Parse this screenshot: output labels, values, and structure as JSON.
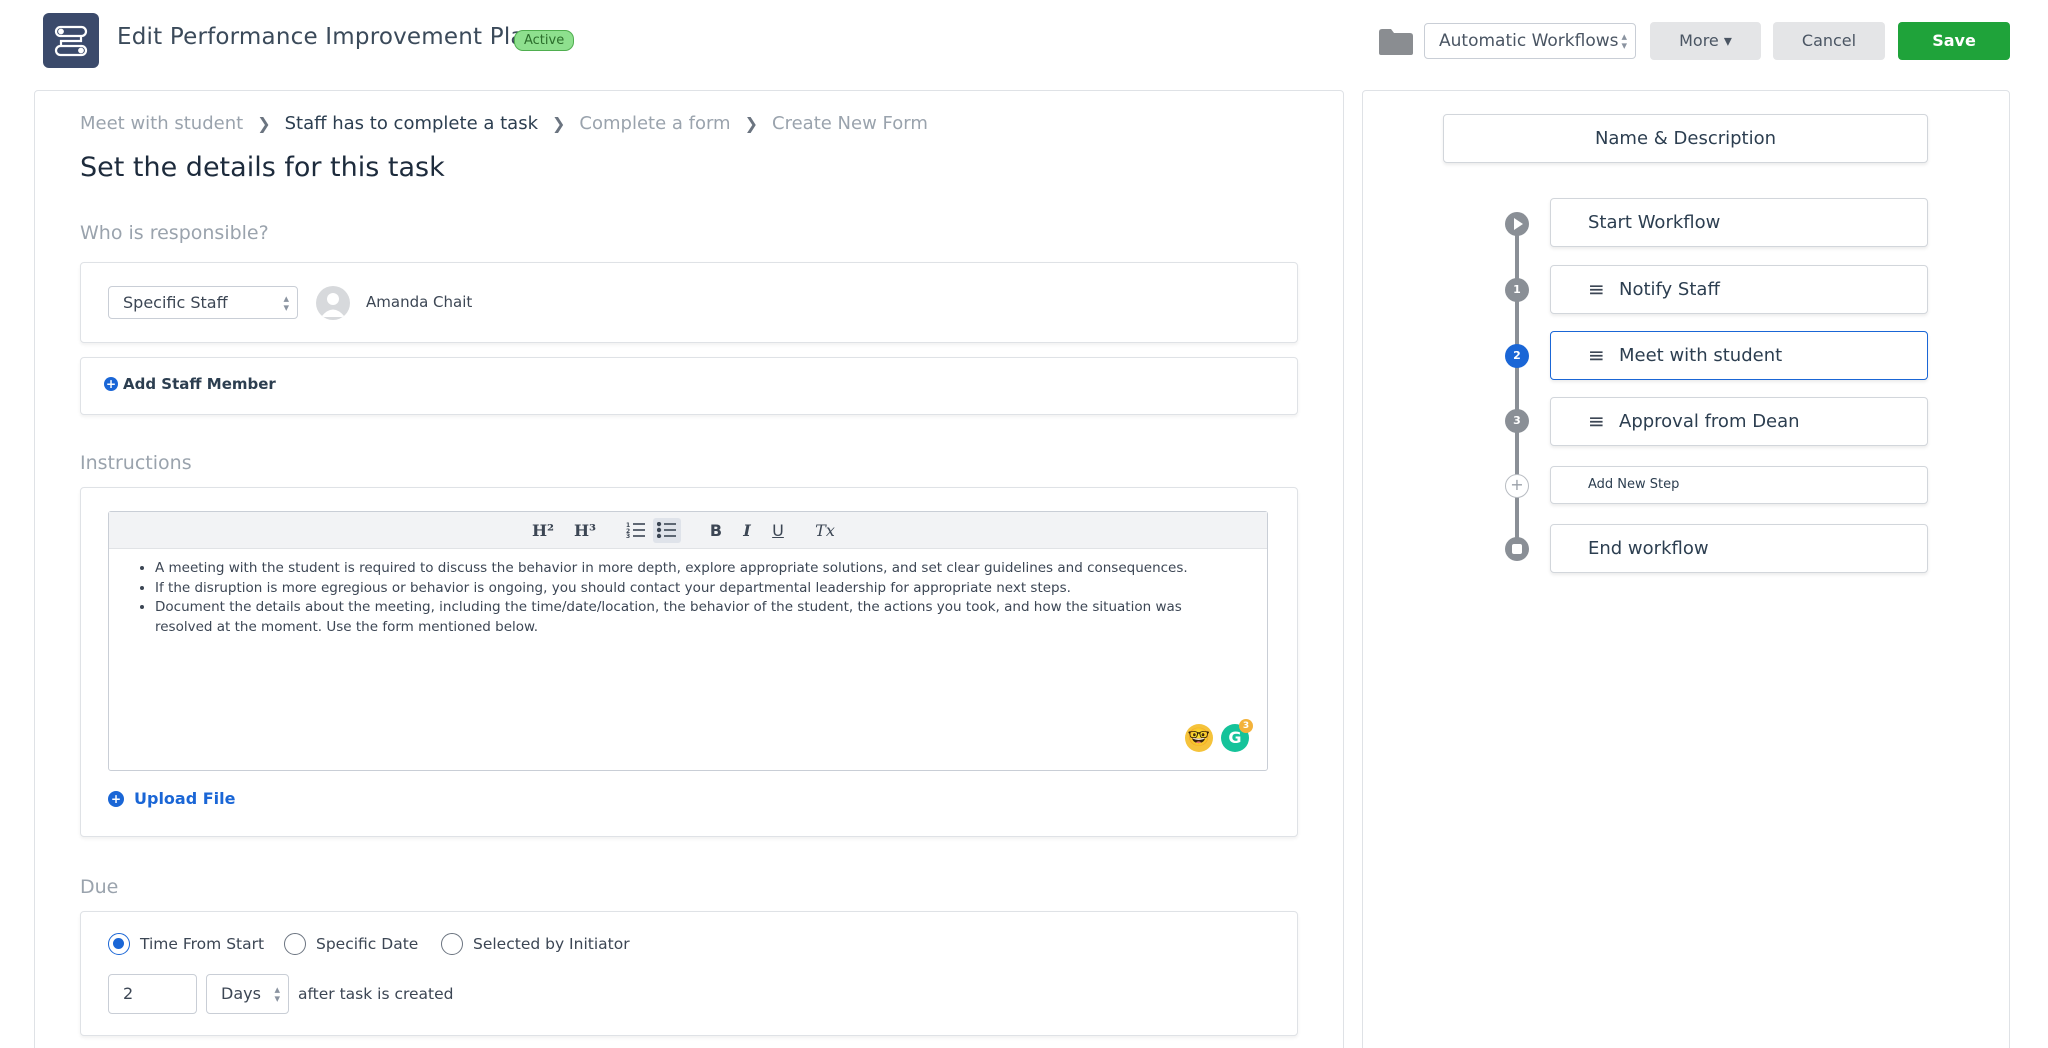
{
  "header": {
    "title": "Edit Performance Improvement Plan",
    "status_badge": "Active",
    "workflow_select": "Automatic Workflows",
    "more_label": "More",
    "cancel_label": "Cancel",
    "save_label": "Save"
  },
  "breadcrumb": [
    "Meet with student",
    "Staff has to complete a task",
    "Complete a form",
    "Create New Form"
  ],
  "task": {
    "title": "Set the details for this task",
    "responsible_label": "Who is responsible?",
    "responsible_type": "Specific Staff",
    "staff_name": "Amanda Chait",
    "add_staff_label": "Add Staff Member",
    "instructions_label": "Instructions",
    "instructions": [
      "A meeting with the student is required to discuss the behavior in more depth, explore appropriate solutions, and set clear guidelines and consequences.",
      "If the disruption is more egregious or behavior is ongoing, you should contact your departmental leadership for appropriate next steps.",
      "Document the details about the meeting, including the time/date/location, the behavior of the student, the actions you took, and how the situation was resolved at the moment. Use the form mentioned below."
    ],
    "grammarly_count": "3",
    "upload_label": "Upload File",
    "due_label": "Due",
    "due_options": [
      "Time From Start",
      "Specific Date",
      "Selected by Initiator"
    ],
    "due_selected": "Time From Start",
    "due_amount": "2",
    "due_unit": "Days",
    "due_suffix": "after task is created"
  },
  "toolbar": {
    "h2": "H²",
    "h3": "H³",
    "bold": "B",
    "italic": "I",
    "underline": "U",
    "clear": "Tx"
  },
  "workflow": {
    "name_desc_label": "Name & Description",
    "start_label": "Start Workflow",
    "steps": [
      {
        "number": "1",
        "label": "Notify Staff"
      },
      {
        "number": "2",
        "label": "Meet with student"
      },
      {
        "number": "3",
        "label": "Approval from Dean"
      }
    ],
    "add_step_label": "Add New Step",
    "end_label": "End workflow"
  },
  "colors": {
    "accent": "#1a66d6",
    "save_button": "#1fa33a",
    "active_badge": "#8ee08e"
  }
}
